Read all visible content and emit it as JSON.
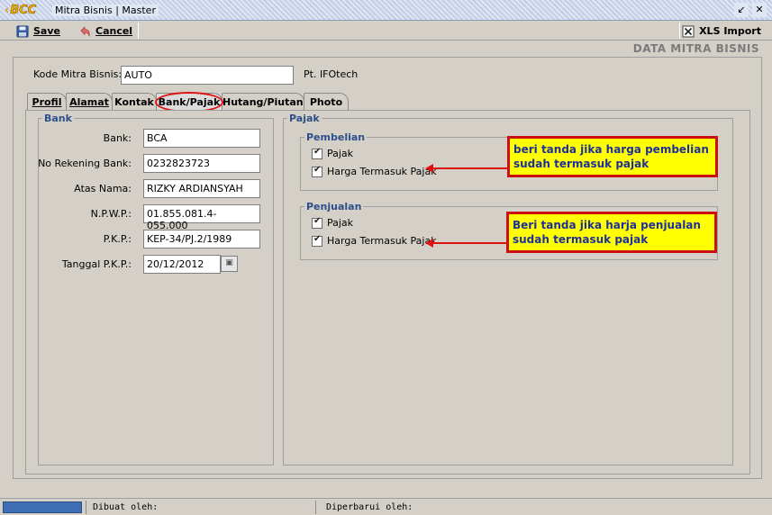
{
  "window": {
    "logo_text": "BCC",
    "title": "Mitra Bisnis | Master"
  },
  "toolbar": {
    "save_label": "Save",
    "cancel_label": "Cancel",
    "xls_label": "XLS Import"
  },
  "heading": "DATA MITRA BISNIS",
  "header_form": {
    "kode_label": "Kode Mitra Bisnis:",
    "kode_value": "AUTO",
    "company": "Pt. IFOtech"
  },
  "tabs": [
    {
      "label": "Profil",
      "active": false
    },
    {
      "label": "Alamat",
      "active": false
    },
    {
      "label": "Kontak",
      "active": false
    },
    {
      "label": "Bank/Pajak",
      "active": true
    },
    {
      "label": "Hutang/Piutang",
      "active": false
    },
    {
      "label": "Photo",
      "active": false
    }
  ],
  "bank": {
    "title": "Bank",
    "fields": [
      {
        "label": "Bank:",
        "value": "BCA"
      },
      {
        "label": "No Rekening Bank:",
        "value": "0232823723"
      },
      {
        "label": "Atas Nama:",
        "value": "RIZKY ARDIANSYAH"
      },
      {
        "label": "N.P.W.P.:",
        "value": "01.855.081.4-055.000"
      },
      {
        "label": "P.K.P.:",
        "value": "KEP-34/PJ.2/1989"
      },
      {
        "label": "Tanggal P.K.P.:",
        "value": "20/12/2012"
      }
    ]
  },
  "pajak": {
    "title": "Pajak",
    "pembelian": {
      "title": "Pembelian",
      "pajak_label": "Pajak",
      "pajak_checked": true,
      "harga_label": "Harga Termasuk Pajak",
      "harga_checked": true
    },
    "penjualan": {
      "title": "Penjualan",
      "pajak_label": "Pajak",
      "pajak_checked": true,
      "harga_label": "Harga Termasuk Pajak",
      "harga_checked": true
    }
  },
  "callouts": {
    "pembelian_line1": "beri tanda jika harga pembelian",
    "pembelian_line2": "sudah termasuk pajak",
    "penjualan_line1": "Beri tanda jika harja penjualan",
    "penjualan_line2": "sudah termasuk pajak"
  },
  "status": {
    "dibuat": "Dibuat oleh:",
    "diperbarui": "Diperbarui oleh:"
  },
  "colors": {
    "callout_bg": "#ffff00",
    "callout_border": "#cc1010",
    "callout_text": "#1f2f9a",
    "group_title": "#2d4f8a",
    "annotation_red": "#e01010"
  }
}
